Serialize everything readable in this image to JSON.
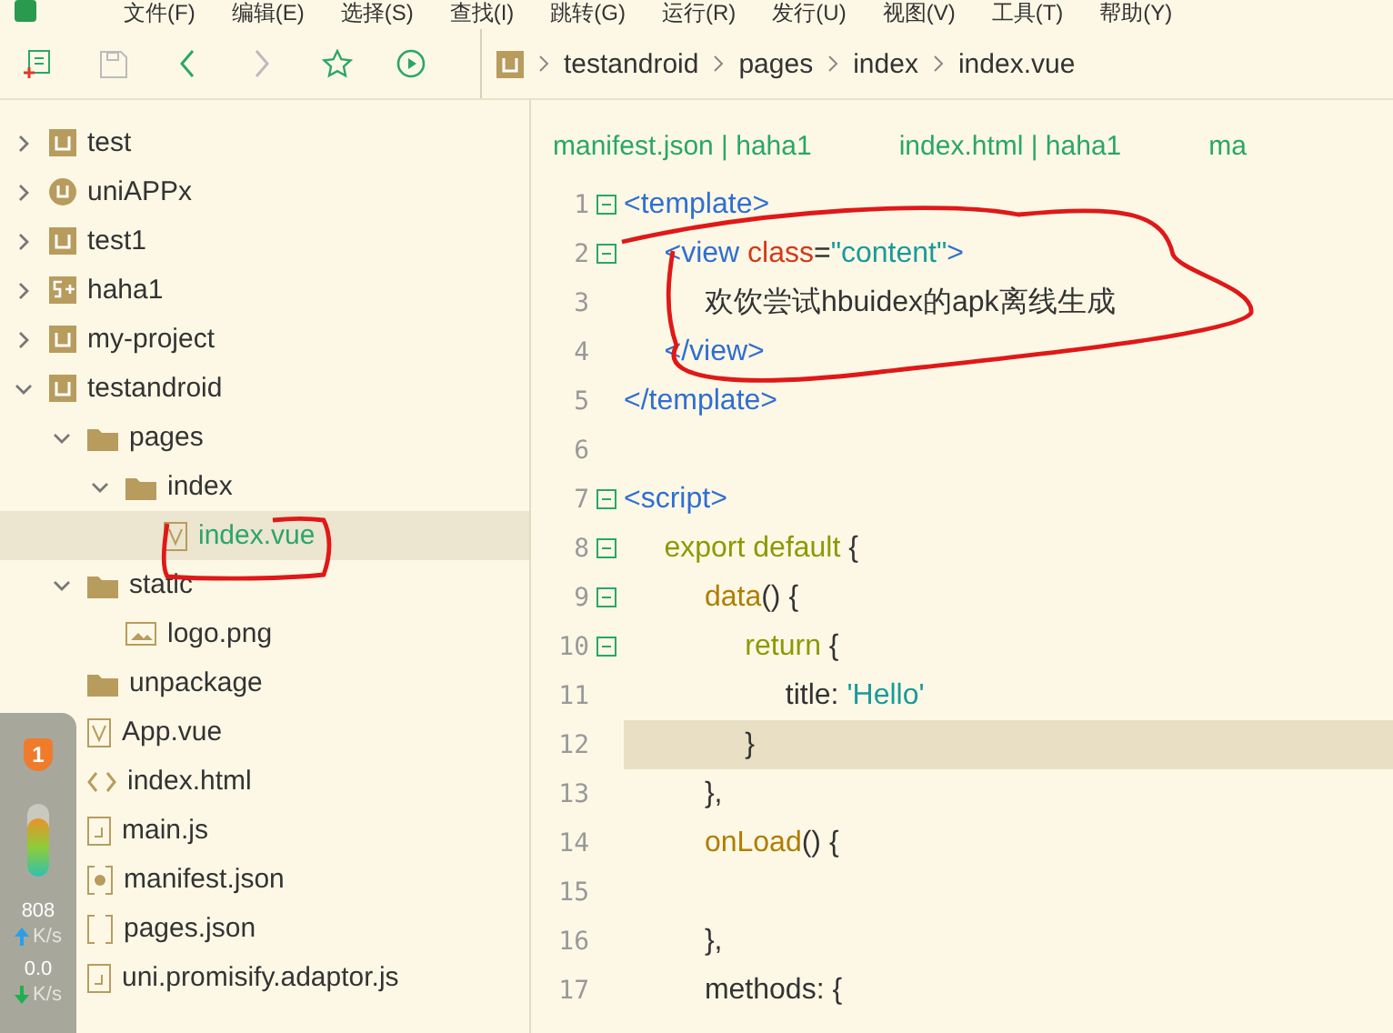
{
  "menu": [
    "文件(F)",
    "编辑(E)",
    "选择(S)",
    "查找(I)",
    "跳转(G)",
    "运行(R)",
    "发行(U)",
    "视图(V)",
    "工具(T)",
    "帮助(Y)"
  ],
  "toolbar": [
    {
      "kind": "new-file",
      "disabled": false
    },
    {
      "kind": "save",
      "disabled": true
    },
    {
      "kind": "back",
      "disabled": false
    },
    {
      "kind": "forward",
      "disabled": true
    },
    {
      "kind": "star",
      "disabled": false
    },
    {
      "kind": "run",
      "disabled": false
    }
  ],
  "breadcrumb": [
    "testandroid",
    "pages",
    "index",
    "index.vue"
  ],
  "tree": [
    {
      "label": "test",
      "kind": "project",
      "expanded": false,
      "selected": false
    },
    {
      "label": "uniAPPx",
      "kind": "project-x",
      "expanded": false,
      "selected": false
    },
    {
      "label": "test1",
      "kind": "project",
      "expanded": false,
      "selected": false
    },
    {
      "label": "haha1",
      "kind": "project-5plus",
      "expanded": false,
      "selected": false
    },
    {
      "label": "my-project",
      "kind": "project",
      "expanded": false,
      "selected": false
    },
    {
      "label": "testandroid",
      "kind": "project",
      "expanded": true,
      "selected": false,
      "children": [
        {
          "label": "pages",
          "kind": "folder",
          "expanded": true,
          "selected": false,
          "children": [
            {
              "label": "index",
              "kind": "folder",
              "expanded": true,
              "selected": false,
              "children": [
                {
                  "label": "index.vue",
                  "kind": "vue",
                  "selected": true
                }
              ]
            }
          ]
        },
        {
          "label": "static",
          "kind": "folder",
          "expanded": true,
          "selected": false,
          "children": [
            {
              "label": "logo.png",
              "kind": "image",
              "selected": false
            }
          ]
        },
        {
          "label": "unpackage",
          "kind": "folder",
          "selected": false
        },
        {
          "label": "App.vue",
          "kind": "vue",
          "selected": false
        },
        {
          "label": "index.html",
          "kind": "html",
          "selected": false
        },
        {
          "label": "main.js",
          "kind": "js",
          "selected": false
        },
        {
          "label": "manifest.json",
          "kind": "settings",
          "selected": false
        },
        {
          "label": "pages.json",
          "kind": "brackets",
          "selected": false
        },
        {
          "label": "uni.promisify.adaptor.js",
          "kind": "js",
          "selected": false
        }
      ]
    }
  ],
  "tabs": [
    "manifest.json | haha1",
    "index.html | haha1",
    "ma"
  ],
  "code": [
    {
      "number": "1",
      "fold": true,
      "current": false,
      "tokens": [
        {
          "text": "<template>",
          "kind": "tag"
        }
      ]
    },
    {
      "number": "2",
      "fold": true,
      "current": false,
      "tokens": [
        {
          "text": "     <view ",
          "kind": "tag"
        },
        {
          "text": "class",
          "kind": "attr"
        },
        {
          "text": "=",
          "kind": "plain"
        },
        {
          "text": "\"content\"",
          "kind": "string"
        },
        {
          "text": ">",
          "kind": "tag"
        }
      ]
    },
    {
      "number": "3",
      "fold": false,
      "current": false,
      "tokens": [
        {
          "text": "          欢饮尝试hbuidex的apk离线生成",
          "kind": "plain"
        }
      ]
    },
    {
      "number": "4",
      "fold": false,
      "current": false,
      "tokens": [
        {
          "text": "     </view>",
          "kind": "tag"
        }
      ]
    },
    {
      "number": "5",
      "fold": false,
      "current": false,
      "tokens": [
        {
          "text": "</template>",
          "kind": "tag"
        }
      ]
    },
    {
      "number": "6",
      "fold": false,
      "current": false
    },
    {
      "number": "7",
      "fold": true,
      "current": false,
      "tokens": [
        {
          "text": "<script>",
          "kind": "tag"
        }
      ]
    },
    {
      "number": "8",
      "fold": true,
      "current": false,
      "tokens": [
        {
          "text": "     export default",
          "kind": "keyword"
        },
        {
          "text": " {",
          "kind": "plain"
        }
      ]
    },
    {
      "number": "9",
      "fold": true,
      "current": false,
      "tokens": [
        {
          "text": "          data",
          "kind": "function"
        },
        {
          "text": "() {",
          "kind": "plain"
        }
      ]
    },
    {
      "number": "10",
      "fold": true,
      "current": false,
      "tokens": [
        {
          "text": "               return",
          "kind": "keyword"
        },
        {
          "text": " {",
          "kind": "plain"
        }
      ]
    },
    {
      "number": "11",
      "fold": false,
      "current": false,
      "tokens": [
        {
          "text": "                    title: ",
          "kind": "plain"
        },
        {
          "text": "'Hello'",
          "kind": "string"
        }
      ]
    },
    {
      "number": "12",
      "fold": false,
      "current": true,
      "tokens": [
        {
          "text": "               }",
          "kind": "plain"
        }
      ]
    },
    {
      "number": "13",
      "fold": false,
      "current": false,
      "tokens": [
        {
          "text": "          },",
          "kind": "plain"
        }
      ]
    },
    {
      "number": "14",
      "fold": false,
      "current": false,
      "tokens": [
        {
          "text": "          onLoad",
          "kind": "function"
        },
        {
          "text": "() {",
          "kind": "plain"
        }
      ]
    },
    {
      "number": "15",
      "fold": false,
      "current": false
    },
    {
      "number": "16",
      "fold": false,
      "current": false,
      "tokens": [
        {
          "text": "          },",
          "kind": "plain"
        }
      ]
    },
    {
      "number": "17",
      "fold": false,
      "current": false,
      "tokens": [
        {
          "text": "          methods: {",
          "kind": "plain"
        }
      ]
    }
  ],
  "widget": {
    "badge": "1",
    "upload": "808",
    "upload_unit": "K/s",
    "download": "0.0",
    "download_unit": "K/s"
  }
}
